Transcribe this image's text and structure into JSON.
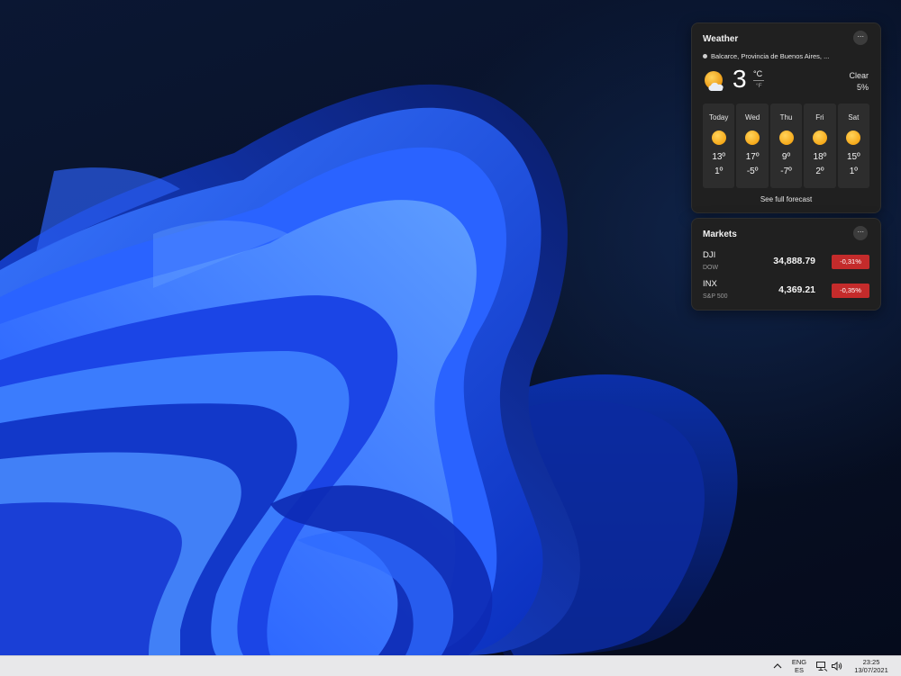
{
  "weather": {
    "title": "Weather",
    "more": "···",
    "location": "Balcarce, Provincia de Buenos Aires, ...",
    "temperature": "3",
    "unit_c": "°C",
    "unit_f": "°F",
    "condition": "Clear",
    "precipitation": "5%",
    "current_icon": "sun-cloud-icon",
    "forecast": [
      {
        "day": "Today",
        "high": "13º",
        "low": "1º",
        "icon": "sun-icon"
      },
      {
        "day": "Wed",
        "high": "17º",
        "low": "-5º",
        "icon": "sun-icon"
      },
      {
        "day": "Thu",
        "high": "9º",
        "low": "-7º",
        "icon": "sun-icon"
      },
      {
        "day": "Fri",
        "high": "18º",
        "low": "2º",
        "icon": "sun-icon"
      },
      {
        "day": "Sat",
        "high": "15º",
        "low": "1º",
        "icon": "sun-icon"
      }
    ],
    "full_forecast": "See full forecast"
  },
  "markets": {
    "title": "Markets",
    "more": "···",
    "rows": [
      {
        "ticker": "DJI",
        "name": "DOW",
        "price": "34,888.79",
        "change": "-0,31%"
      },
      {
        "ticker": "INX",
        "name": "S&P 500",
        "price": "4,369.21",
        "change": "-0,35%"
      }
    ]
  },
  "taskbar": {
    "lang_1": "ENG",
    "lang_2": "ES",
    "time": "23:25",
    "date": "13/07/2021"
  },
  "colors": {
    "negative": "#c42b2b",
    "card_bg": "#202020",
    "wallpaper_accent": "#1f4dff"
  }
}
